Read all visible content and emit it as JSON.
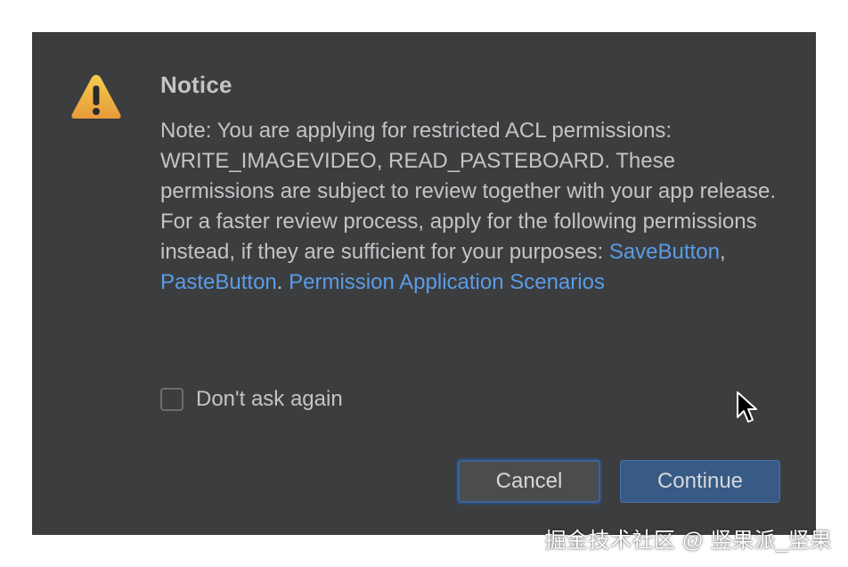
{
  "dialog": {
    "title": "Notice",
    "icon": "warning-triangle-icon",
    "message_intro": "Note: You are applying for restricted ACL permissions: WRITE_IMAGEVIDEO, READ_PASTEBOARD. These permissions are subject to review together with your app release. For a faster review process, apply for the following permissions instead, if they are sufficient for your purposes: ",
    "links": {
      "save_button": "SaveButton",
      "separator_1": ", ",
      "paste_button": "PasteButton",
      "separator_2": ". ",
      "scenarios": "Permission Application Scenarios"
    },
    "checkbox": {
      "label": "Don't ask again",
      "checked": false
    },
    "buttons": {
      "cancel": "Cancel",
      "continue": "Continue"
    }
  },
  "watermark": "掘金技术社区 @ 竖果派_坚果",
  "colors": {
    "dialog_bg": "#3c3d3f",
    "text": "#c3c4c6",
    "link": "#5b9ce8",
    "primary_button": "#375a86",
    "focus_ring": "#3d6495",
    "warning": "#f0b43c"
  }
}
